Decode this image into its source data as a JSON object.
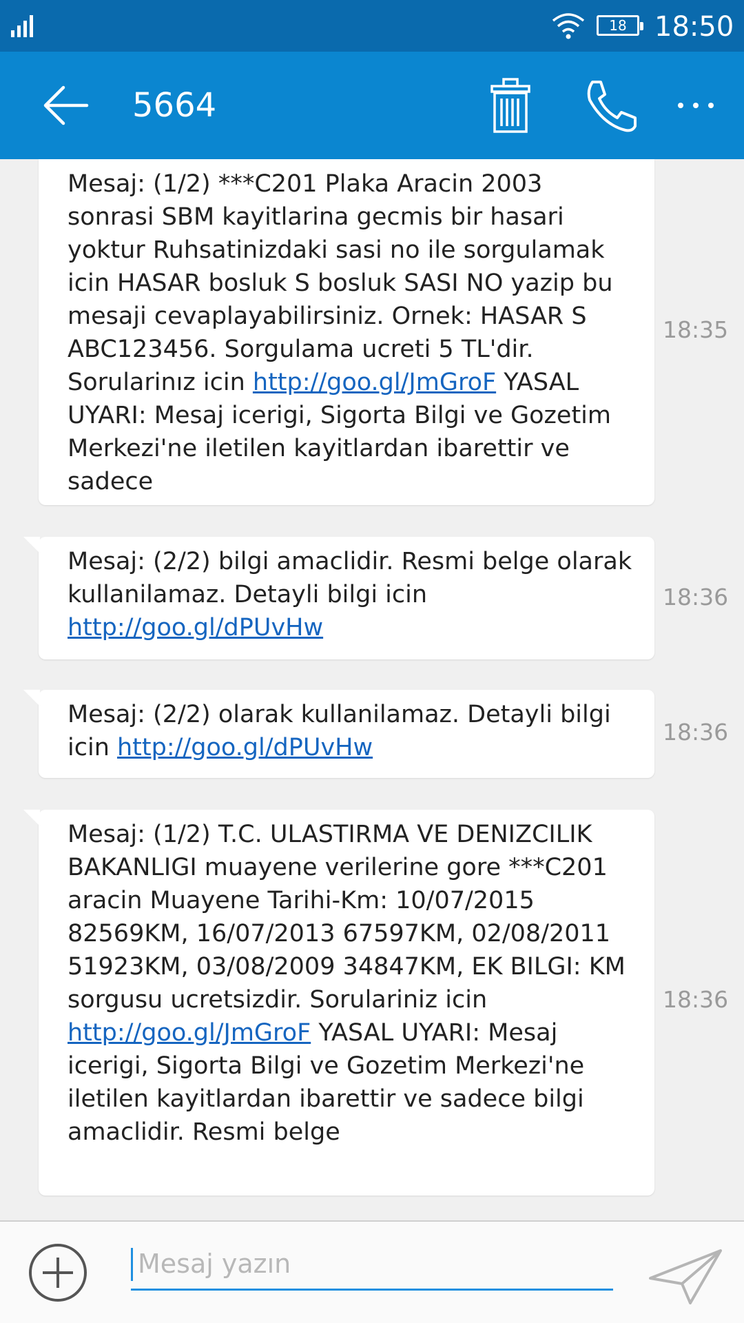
{
  "status_bar": {
    "battery": "18",
    "time": "18:50"
  },
  "app_bar": {
    "title": "5664"
  },
  "messages": [
    {
      "parts": [
        {
          "text": "Mesaj: (1/2) ***C201 Plaka Aracin 2003 sonrasi SBM kayitlarina gecmis bir hasari yoktur Ruhsatinizdaki sasi no ile sorgulamak icin HASAR bosluk S bosluk SASI NO yazip bu mesaji cevaplayabilirsiniz. Ornek: HASAR S ABC123456. Sorgulama ucreti 5 TL'dir. Sorularinız icin "
        },
        {
          "link": "http://goo.gl/JmGroF"
        },
        {
          "text": " YASAL UYARI: Mesaj icerigi, Sigorta Bilgi ve Gozetim Merkezi'ne iletilen kayitlardan ibarettir ve sadece"
        }
      ],
      "time": "18:35"
    },
    {
      "parts": [
        {
          "text": "Mesaj: (2/2) bilgi amaclidir. Resmi belge olarak kullanilamaz. Detayli bilgi icin "
        },
        {
          "link": "http://goo.gl/dPUvHw"
        }
      ],
      "time": "18:36"
    },
    {
      "parts": [
        {
          "text": "Mesaj: (2/2) olarak kullanilamaz. Detayli bilgi icin "
        },
        {
          "link": "http://goo.gl/dPUvHw"
        }
      ],
      "time": "18:36"
    },
    {
      "parts": [
        {
          "text": "Mesaj: (1/2) T.C. ULASTIRMA VE DENIZCILIK BAKANLIGI muayene verilerine gore ***C201 aracin Muayene Tarihi-Km: 10/07/2015 82569KM, 16/07/2013 67597KM, 02/08/2011 51923KM, 03/08/2009 34847KM, EK BILGI: KM sorgusu ucretsizdir. Sorulariniz icin "
        },
        {
          "link": "http://goo.gl/JmGroF"
        },
        {
          "text": " YASAL UYARI: Mesaj icerigi, Sigorta Bilgi ve Gozetim Merkezi'ne iletilen kayitlardan ibarettir ve sadece bilgi amaclidir. Resmi belge"
        }
      ],
      "time": "18:36"
    }
  ],
  "composer": {
    "placeholder": "Mesaj yazın"
  },
  "icons": {
    "signal": "signal-icon",
    "wifi": "wifi-icon",
    "back": "arrow-left-icon",
    "trash": "trash-icon",
    "phone": "phone-icon",
    "more": "more-horizontal-icon",
    "add": "plus-circle-icon",
    "send": "send-icon"
  }
}
